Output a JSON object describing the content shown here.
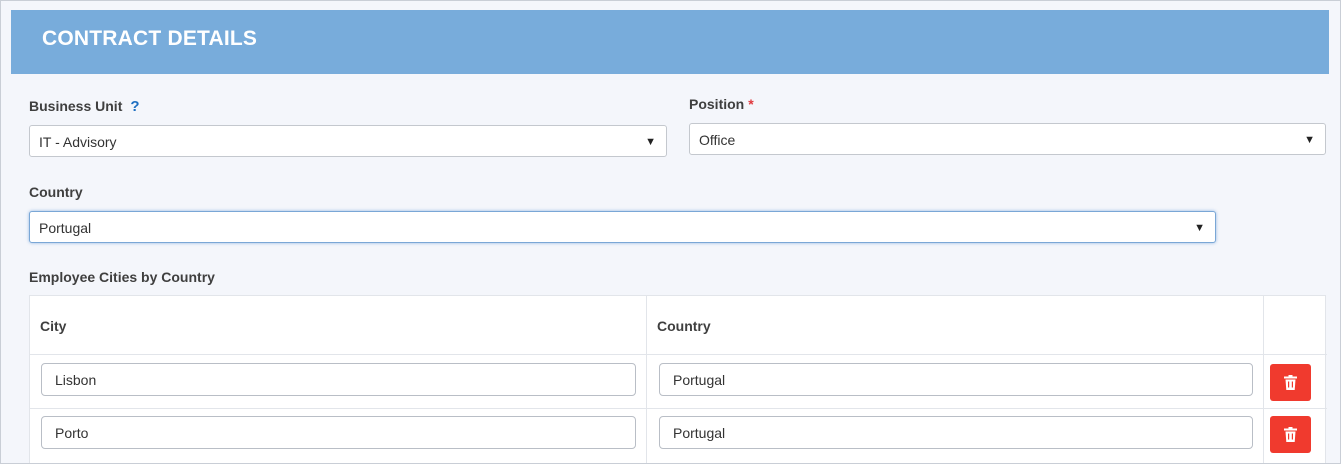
{
  "header": {
    "title": "CONTRACT DETAILS"
  },
  "business_unit": {
    "label": "Business Unit",
    "help": "?",
    "value": "IT - Advisory"
  },
  "position": {
    "label": "Position",
    "required": "*",
    "value": "Office"
  },
  "country": {
    "label": "Country",
    "value": "Portugal"
  },
  "cities_table": {
    "title": "Employee Cities by Country",
    "columns": [
      "City",
      "Country"
    ],
    "rows": [
      {
        "city": "Lisbon",
        "country": "Portugal"
      },
      {
        "city": "Porto",
        "country": "Portugal"
      }
    ]
  },
  "colors": {
    "header_bg": "#78acdb",
    "delete_button": "#f03a2e",
    "help_icon": "#1e6fc1",
    "required_marker": "#e0393e"
  },
  "icons": {
    "dropdown": "caret-down-icon",
    "delete": "trash-icon"
  }
}
